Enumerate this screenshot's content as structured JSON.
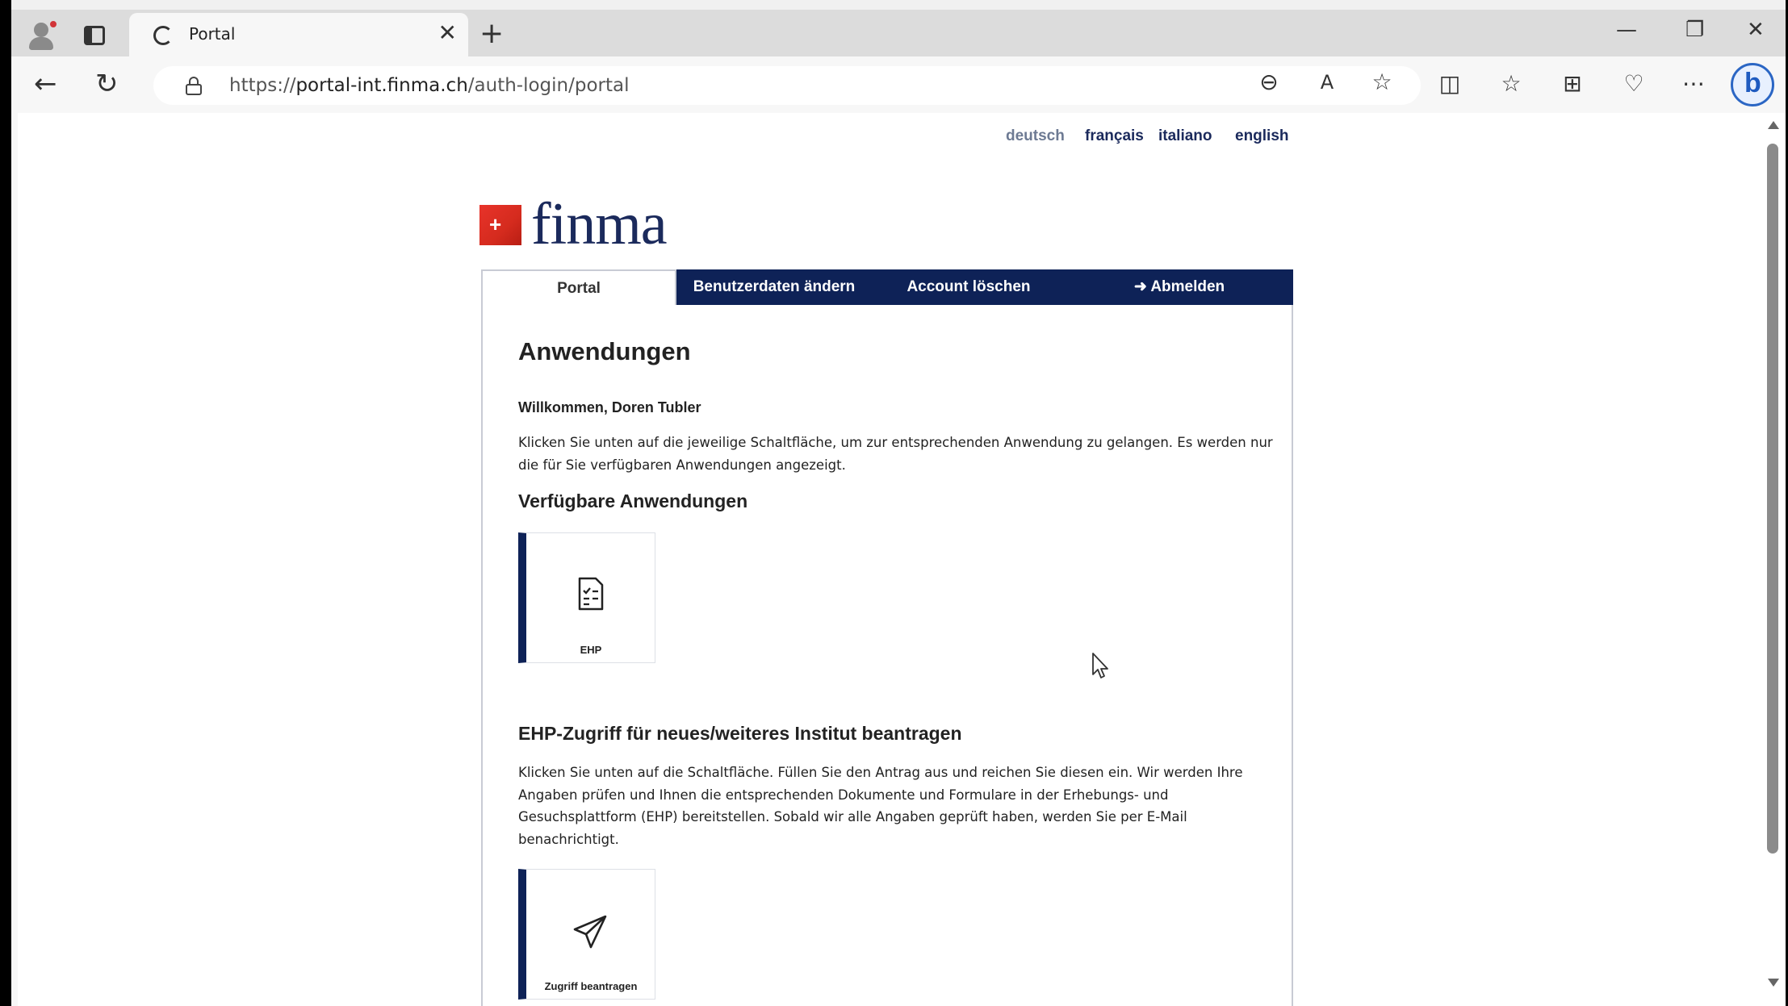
{
  "browser": {
    "tab_title": "Portal",
    "tab_close": "✕",
    "new_tab": "+",
    "url_scheme": "https://",
    "url_host": "portal-int.finma.ch",
    "url_path": "/auth-login/portal",
    "minimize": "—",
    "maximize": "❐",
    "close": "✕",
    "back": "←",
    "reload": "↻",
    "zoom_icon": "⊖",
    "read_aloud": "A",
    "favorite": "☆",
    "split": "◫",
    "favorites": "☆",
    "collections": "⊞",
    "health": "♡",
    "more": "⋯",
    "bing": "b"
  },
  "languages": [
    "deutsch",
    "français",
    "italiano",
    "english"
  ],
  "active_language": "deutsch",
  "logo_text": "finma",
  "nav": {
    "portal": "Portal",
    "change_user": "Benutzerdaten ändern",
    "delete_account": "Account löschen",
    "logout": "Abmelden",
    "logout_icon": "➜"
  },
  "main": {
    "heading": "Anwendungen",
    "welcome": "Willkommen, Doren Tubler",
    "intro": "Klicken Sie unten auf die jeweilige Schaltfläche, um zur entsprechenden Anwendung zu gelangen. Es werden nur die für Sie verfügbaren Anwendungen angezeigt.",
    "available_heading": "Verfügbare Anwendungen",
    "app_ehp_label": "EHP",
    "request_heading": "EHP-Zugriff für neues/weiteres Institut beantragen",
    "request_text": "Klicken Sie unten auf die Schaltfläche. Füllen Sie den Antrag aus und reichen Sie diesen ein. Wir werden Ihre Angaben prüfen und Ihnen die entsprechenden Dokumente und Formulare in der Erhebungs- und Gesuchsplattform (EHP) bereitstellen. Sobald wir alle Angaben geprüft haben, werden Sie per E-Mail benachrichtigt.",
    "request_button_label": "Zugriff beantragen"
  },
  "colors": {
    "navy": "#0e2257",
    "swiss_red": "#d52b1e"
  }
}
